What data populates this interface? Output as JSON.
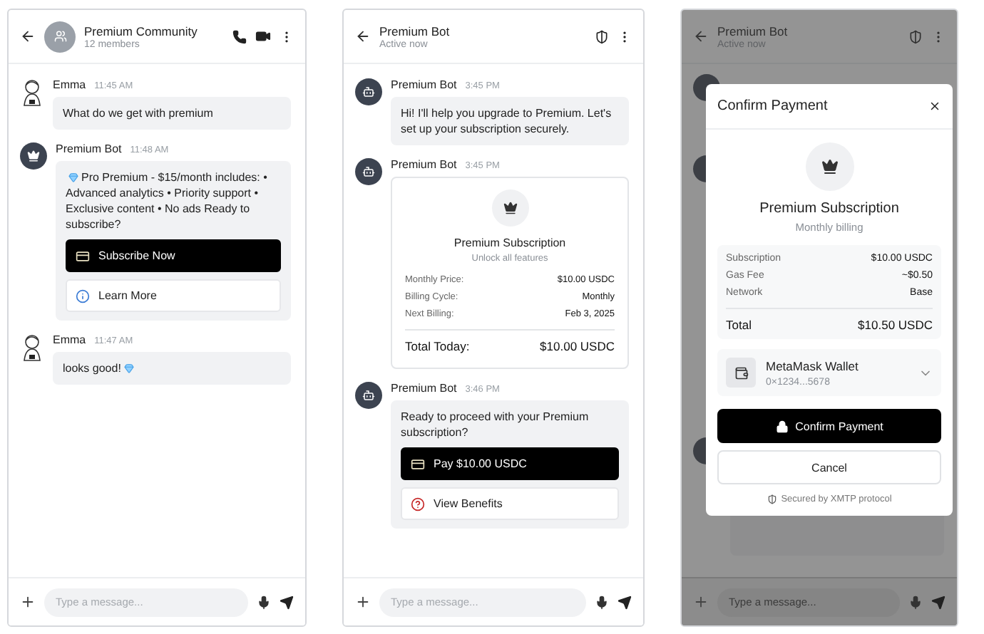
{
  "screens": [
    {
      "header": {
        "kind": "group",
        "title": "Premium Community",
        "subtitle": "12 members"
      },
      "messages": [
        {
          "sender": "Emma",
          "time": "11:45 AM",
          "kind": "person",
          "text": "What do we get with premium",
          "leading_gem": false,
          "trailing_gem": false
        },
        {
          "sender": "Premium Bot",
          "time": "11:48 AM",
          "kind": "crown_bot",
          "text": "Pro Premium - $15/month includes: • Advanced analytics • Priority support • Exclusive content • No ads Ready to subscribe?",
          "leading_gem": true,
          "trailing_gem": false,
          "buttons": [
            {
              "label": "Subscribe Now",
              "kind": "pay",
              "primary": true
            },
            {
              "label": "Learn More",
              "kind": "info",
              "primary": false
            }
          ]
        },
        {
          "sender": "Emma",
          "time": "11:47 AM",
          "kind": "person",
          "text": "looks good!",
          "leading_gem": false,
          "trailing_gem": true
        }
      ],
      "composer": {
        "placeholder": "Type a message..."
      }
    },
    {
      "header": {
        "kind": "bot",
        "title": "Premium Bot",
        "subtitle": "Active now"
      },
      "messages": [
        {
          "sender": "Premium Bot",
          "time": "3:45 PM",
          "kind": "robot_bot",
          "text": "Hi! I'll help you upgrade to Premium. Let's set up your subscription securely.",
          "leading_gem": false,
          "trailing_gem": false
        },
        {
          "sender": "Premium Bot",
          "time": "3:45 PM",
          "kind": "robot_bot",
          "card": {
            "title": "Premium Subscription",
            "subtitle": "Unlock all features",
            "rows": [
              {
                "label": "Monthly Price:",
                "value": "$10.00 USDC"
              },
              {
                "label": "Billing Cycle:",
                "value": "Monthly"
              },
              {
                "label": "Next Billing:",
                "value": "Feb 3, 2025"
              }
            ],
            "total": {
              "label": "Total Today:",
              "value": "$10.00 USDC"
            }
          }
        },
        {
          "sender": "Premium Bot",
          "time": "3:46 PM",
          "kind": "robot_bot",
          "text": "Ready to proceed with your Premium subscription?",
          "leading_gem": false,
          "trailing_gem": false,
          "buttons": [
            {
              "label": "Pay $10.00 USDC",
              "kind": "pay",
              "primary": true
            },
            {
              "label": "View Benefits",
              "kind": "help",
              "primary": false
            }
          ]
        }
      ],
      "composer": {
        "placeholder": "Type a message..."
      }
    },
    {
      "header": {
        "kind": "bot",
        "title": "Premium Bot",
        "subtitle": "Active now"
      },
      "composer": {
        "placeholder": "Type a message..."
      },
      "modal": {
        "title": "Confirm Payment",
        "product": "Premium Subscription",
        "note": "Monthly billing",
        "rows": [
          {
            "label": "Subscription",
            "value": "$10.00 USDC"
          },
          {
            "label": "Gas Fee",
            "value": "~$0.50"
          },
          {
            "label": "Network",
            "value": "Base"
          }
        ],
        "total": {
          "label": "Total",
          "value": "$10.50 USDC"
        },
        "wallet": {
          "name": "MetaMask Wallet",
          "address": "0×1234...5678"
        },
        "confirm": "Confirm Payment",
        "cancel": "Cancel",
        "footer": "Secured by XMTP protocol"
      }
    }
  ]
}
